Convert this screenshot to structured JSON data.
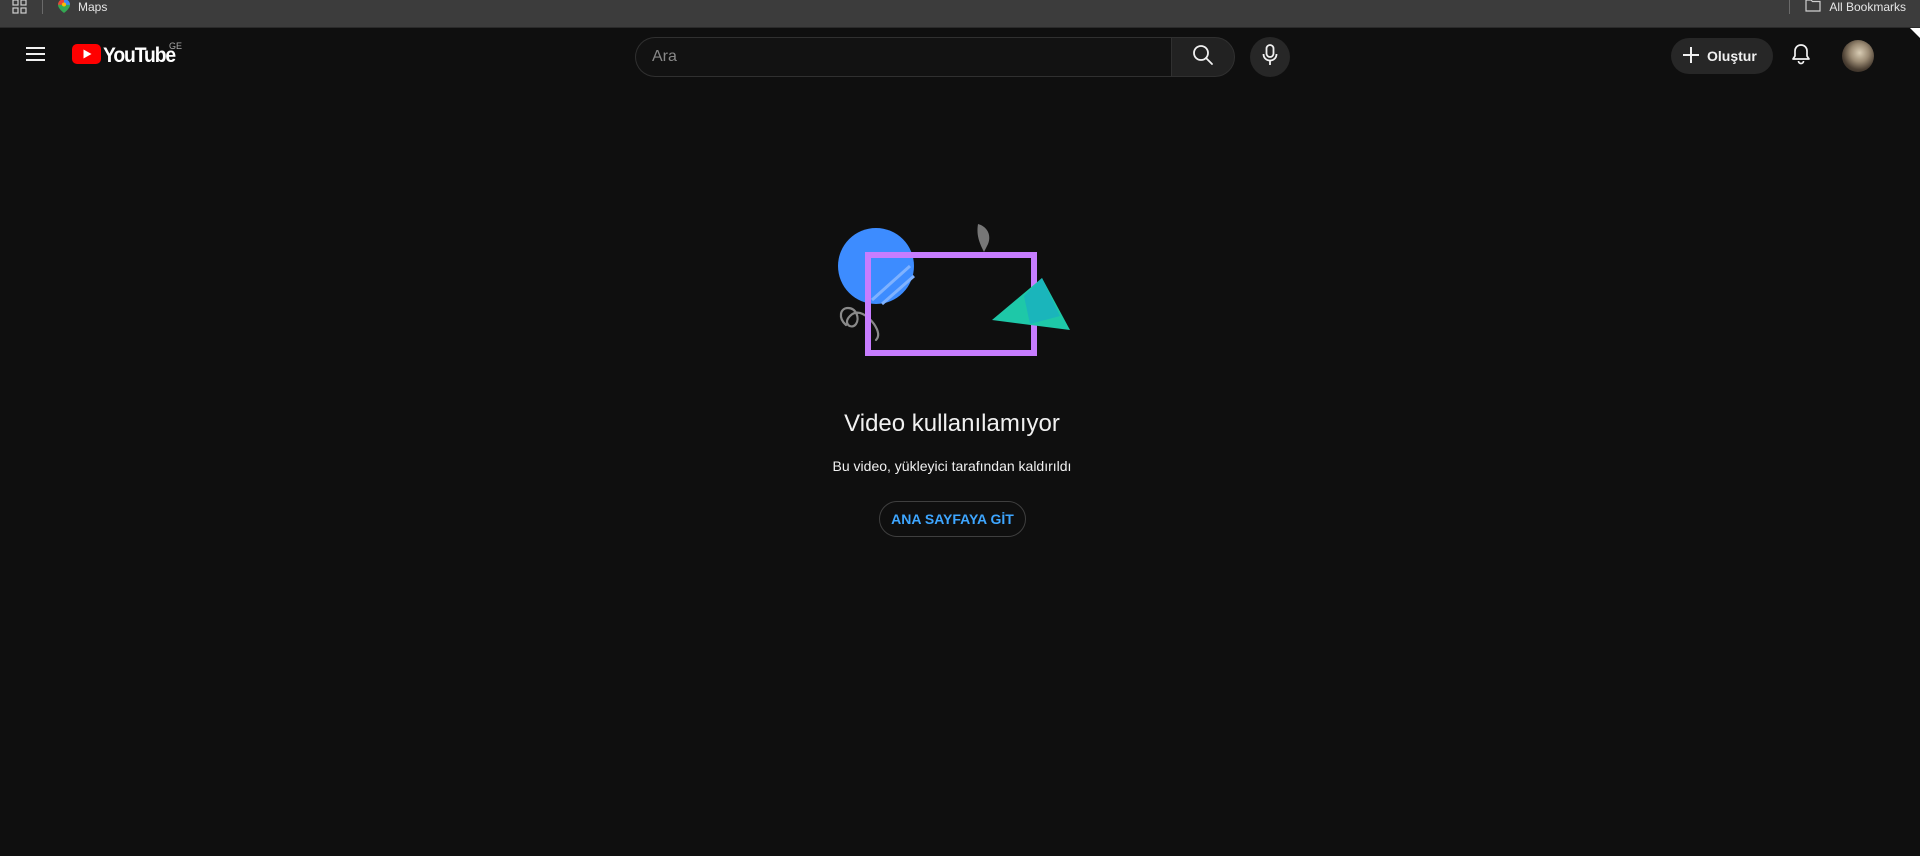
{
  "browser": {
    "bookmarks": {
      "maps_label": "Maps",
      "all_bookmarks_label": "All Bookmarks"
    }
  },
  "header": {
    "logo_text": "YouTube",
    "country_code": "GE",
    "search": {
      "placeholder": "Ara",
      "value": ""
    },
    "create_label": "Oluştur",
    "icons": {
      "menu": "hamburger-menu-icon",
      "search": "search-icon",
      "mic": "microphone-icon",
      "create": "plus-icon",
      "notifications": "bell-icon"
    }
  },
  "main": {
    "title": "Video kullanılamıyor",
    "message": "Bu video, yükleyici tarafından kaldırıldı",
    "home_button_label": "ANA SAYFAYA GİT"
  },
  "colors": {
    "background": "#0f0f0f",
    "brand_red": "#ff0000",
    "link_blue": "#3ea6ff",
    "illustration_purple": "#c77dff",
    "illustration_blue": "#3d8cff",
    "illustration_teal": "#1ec8a8"
  }
}
